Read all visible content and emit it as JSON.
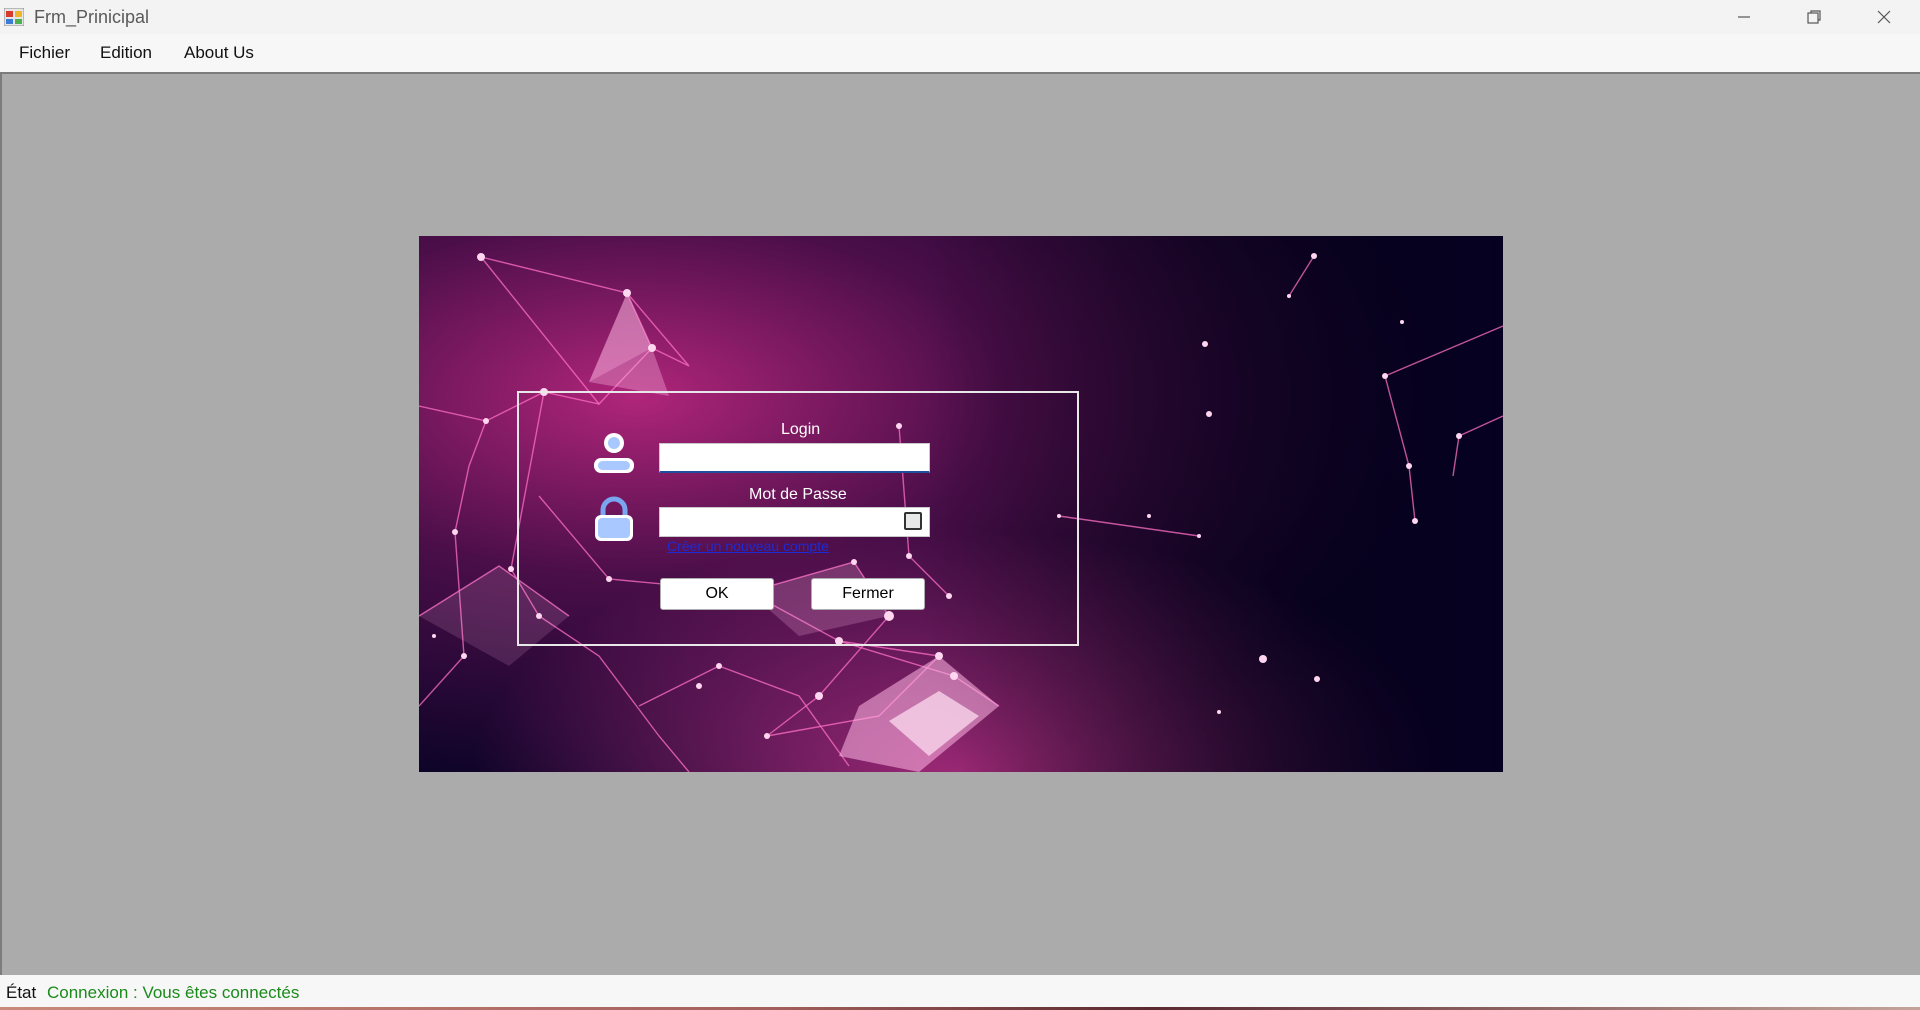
{
  "window": {
    "title": "Frm_Prinicipal",
    "icons": {
      "app": "app-icon",
      "minimize": "minimize-icon",
      "maximize": "restore-icon",
      "close": "close-icon"
    }
  },
  "menu": {
    "items": [
      {
        "label": "Fichier"
      },
      {
        "label": "Edition"
      },
      {
        "label": "About Us"
      }
    ]
  },
  "login": {
    "login_label": "Login",
    "login_value": "",
    "password_label": "Mot de Passe",
    "password_value": "",
    "forgot_link": "Créer un nouveau compte",
    "ok_label": "OK",
    "close_label": "Fermer",
    "icons": {
      "user": "user-icon",
      "lock": "lock-icon",
      "toggle": "show-password-checkbox"
    },
    "background": {
      "primary": "#d0308f",
      "dark": "#0a0326"
    }
  },
  "status": {
    "label": "État",
    "text": "Connexion : Vous êtes connectés",
    "text_color": "#1a8a1a"
  }
}
